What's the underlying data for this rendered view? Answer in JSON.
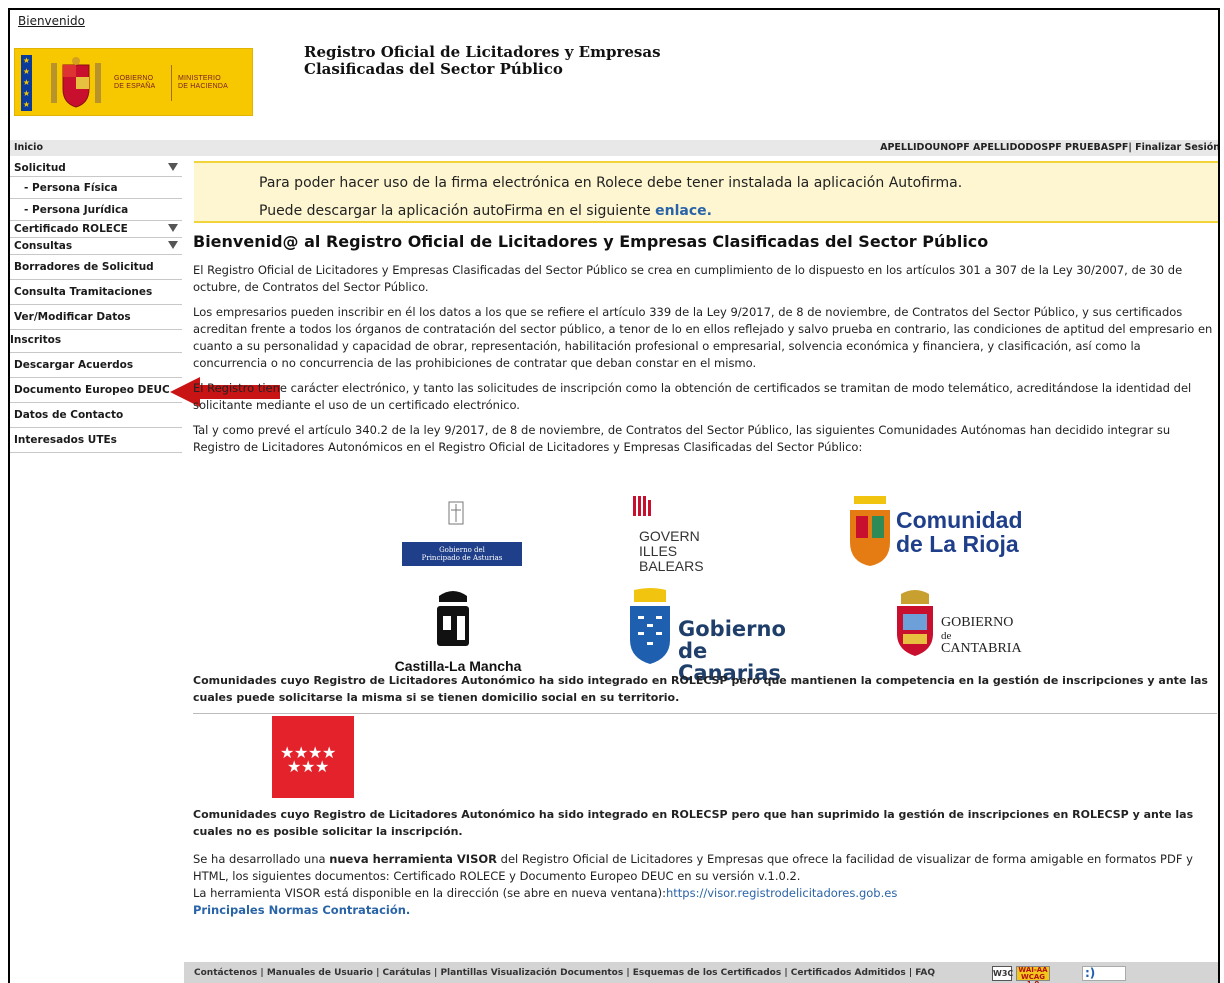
{
  "header": {
    "breadcrumb": "Bienvenido",
    "gov_line1": "GOBIERNO",
    "gov_line2": "DE ESPAÑA",
    "min_line1": "MINISTERIO",
    "min_line2": "DE HACIENDA",
    "site_title_line1": "Registro Oficial de Licitadores y Empresas",
    "site_title_line2": "Clasificadas del Sector Público"
  },
  "topbar": {
    "home": "Inicio",
    "user": "APELLIDOUNOPF APELLIDODOSPF PRUEBASPF| Finalizar Sesión"
  },
  "sidebar": {
    "items": [
      {
        "label": "Solicitud",
        "sub": false,
        "arrow": true
      },
      {
        "label": "- Persona Física",
        "sub": true,
        "arrow": false
      },
      {
        "label": "- Persona Jurídica",
        "sub": true,
        "arrow": false
      },
      {
        "label": "Certificado ROLECE",
        "sub": false,
        "arrow": true
      },
      {
        "label": "Consultas",
        "sub": false,
        "arrow": true
      },
      {
        "label": "Borradores de Solicitud",
        "sub": false,
        "arrow": false
      },
      {
        "label": "Consulta Tramitaciones",
        "sub": false,
        "arrow": false
      },
      {
        "label": "Ver/Modificar Datos",
        "sub": false,
        "arrow": false
      },
      {
        "label": "Inscritos",
        "sub": false,
        "arrow": false
      },
      {
        "label": "Descargar Acuerdos",
        "sub": false,
        "arrow": false
      },
      {
        "label": "Documento Europeo DEUC",
        "sub": false,
        "arrow": false
      },
      {
        "label": "Datos de Contacto",
        "sub": false,
        "arrow": false
      },
      {
        "label": "Interesados UTEs",
        "sub": false,
        "arrow": false
      }
    ]
  },
  "notice": {
    "line1": "Para poder hacer uso de la firma electrónica en Rolece debe tener instalada la aplicación Autofirma.",
    "line2_prefix": "Puede descargar la aplicación autoFirma en el siguiente ",
    "line2_link": "enlace."
  },
  "main": {
    "heading": "Bienvenid@ al Registro Oficial de Licitadores y Empresas Clasificadas del Sector Público",
    "p1": "El Registro Oficial de Licitadores y Empresas Clasificadas del Sector Público se crea en cumplimiento de lo dispuesto en los artículos 301 a 307 de la Ley 30/2007, de 30 de octubre, de Contratos del Sector Público.",
    "p2": "Los empresarios pueden inscribir en él los datos a los que se refiere el artículo 339 de la Ley 9/2017, de 8 de noviembre, de Contratos del Sector Público, y sus certificados acreditan frente a todos los órganos de contratación del sector público, a tenor de lo en ellos reflejado y salvo prueba en contrario, las condiciones de aptitud del empresario en cuanto a su personalidad y capacidad de obrar, representación, habilitación profesional o empresarial, solvencia económica y financiera, y clasificación, así como la concurrencia o no concurrencia de las prohibiciones de contratar que deban constar en el mismo.",
    "p3": "El Registro tiene carácter electrónico, y tanto las solicitudes de inscripción como la obtención de certificados se tramitan de modo telemático, acreditándose la identidad del solicitante mediante el uso de un certificado electrónico.",
    "p4": "Tal y como prevé el artículo 340.2 de la ley 9/2017, de 8 de noviembre, de Contratos del Sector Público, las siguientes Comunidades Autónomas han decidido integrar su Registro de Licitadores Autonómicos en el Registro Oficial de Licitadores y Empresas Clasificadas del Sector Público:",
    "caption1": "Comunidades cuyo Registro de Licitadores Autonómico ha sido integrado en ROLECSP pero que mantienen la competencia en la gestión de inscripciones y ante las cuales puede solicitarse la misma si se tienen domicilio social en su territorio.",
    "caption2": "Comunidades cuyo Registro de Licitadores Autonómico ha sido integrado en ROLECSP pero que han suprimido la gestión de inscripciones en ROLECSP y ante las cuales no es posible solicitar la inscripción.",
    "visor_prefix": "Se ha desarrollado una ",
    "visor_bold": "nueva herramienta VISOR",
    "visor_rest": " del Registro Oficial de Licitadores y Empresas que ofrece la facilidad de visualizar de forma amigable en formatos PDF y HTML, los siguientes documentos: Certificado ROLECE y Documento Europeo DEUC en su versión v.1.0.2.",
    "visor_line2": "La herramienta VISOR está disponible en la dirección (se abre en nueva ventana):",
    "visor_url": "https://visor.registrodelicitadores.gob.es",
    "normas": "Principales Normas Contratación."
  },
  "logos": {
    "asturias_1": "Gobierno del",
    "asturias_2": "Principado de Asturias",
    "baleares_1": "GOVERN",
    "baleares_2": "ILLES",
    "baleares_3": "BALEARS",
    "rioja_1": "Comunidad",
    "rioja_2": "de La Rioja",
    "clm": "Castilla-La Mancha",
    "canarias_1": "Gobierno",
    "canarias_2": "de Canarias",
    "cantabria_1": "GOBIERNO",
    "cantabria_2": "de",
    "cantabria_3": "CANTABRIA"
  },
  "footer": {
    "links": "Contáctenos | Manuales de Usuario | Carátulas | Plantillas Visualización Documentos | Esquemas de los Certificados | Certificados Admitidos | FAQ",
    "w3c": "W3C",
    "wai_1": "WAI-AA",
    "wai_2": "WCAG 1.0"
  },
  "colors": {
    "accent_link": "#2a64a8",
    "notice_bg": "#fdf6d0",
    "notice_border": "#f2d33a",
    "arrow_red": "#c81414"
  }
}
